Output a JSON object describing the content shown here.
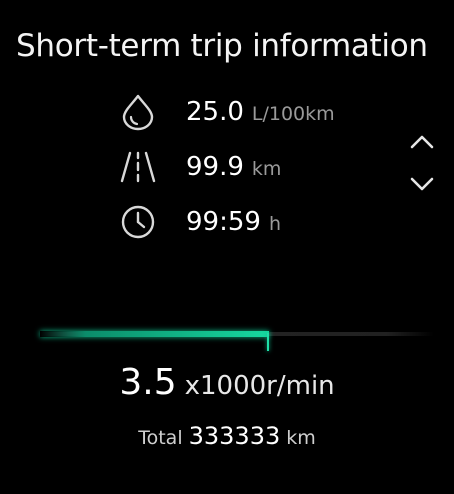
{
  "title": "Short-term trip information",
  "metrics": [
    {
      "icon": "fuel-drop-icon",
      "value": "25.0",
      "unit": "L/100km"
    },
    {
      "icon": "road-distance-icon",
      "value": "99.9",
      "unit": "km"
    },
    {
      "icon": "clock-icon",
      "value": "99:59",
      "unit": "h"
    }
  ],
  "nav": {
    "up_icon": "chevron-up-icon",
    "down_icon": "chevron-down-icon"
  },
  "rpm": {
    "value": "3.5",
    "unit": "x1000r/min",
    "bar_fraction": 0.58
  },
  "total": {
    "label": "Total",
    "value": "333333",
    "unit": "km"
  },
  "colors": {
    "background": "#000000",
    "accent": "#17d9a0",
    "muted_text": "#9a9a9a"
  }
}
